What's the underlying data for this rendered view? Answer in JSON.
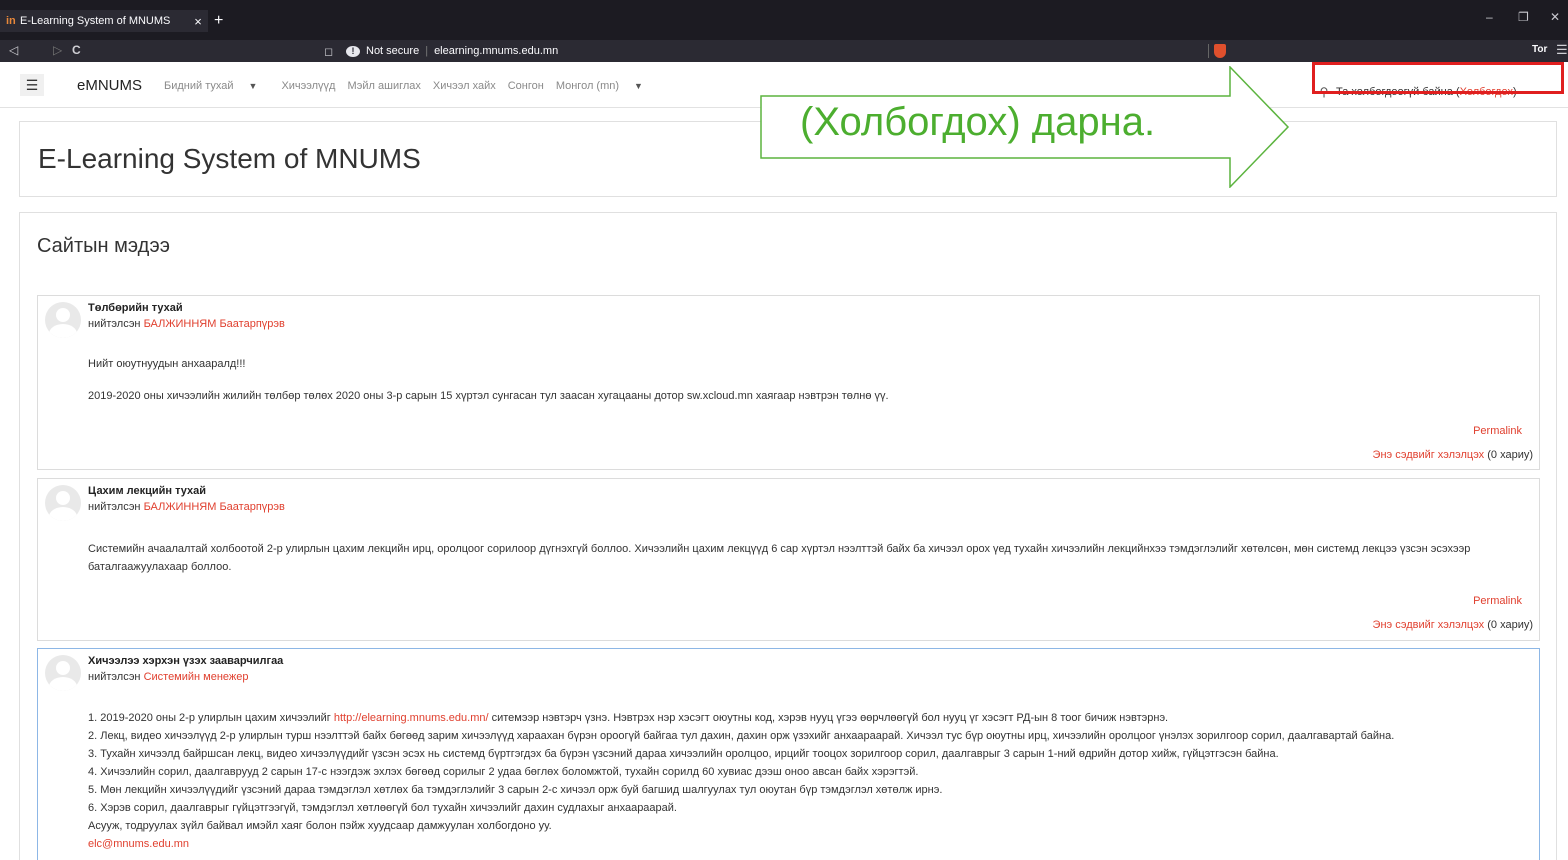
{
  "browser": {
    "tab_favicon": "in",
    "tab_title": "E-Learning System of MNUMS",
    "tab_close": "×",
    "new_tab": "+",
    "security": "Not secure",
    "url": "elearning.mnums.edu.mn",
    "tor_label": "Tor",
    "icons": [
      "back-icon",
      "forward-icon",
      "reload-icon",
      "bookmark-icon",
      "info-icon",
      "brave-shield-icon",
      "menu-icon"
    ]
  },
  "navbar": {
    "brand": "eMNUMS",
    "links": [
      {
        "label": "Бидний тухай",
        "dropdown": true
      },
      {
        "label": "Хичээлүүд",
        "dropdown": false
      },
      {
        "label": "Мэйл ашиглах",
        "dropdown": false
      },
      {
        "label": "Хичээл хайх",
        "dropdown": false
      },
      {
        "label": "Сонгон",
        "dropdown": false
      },
      {
        "label": "Монгол (mn)",
        "dropdown": true
      }
    ],
    "login_text": "Та холбогдоогүй байна (",
    "login_link": "Холбогдох",
    "login_close": ")"
  },
  "page": {
    "heading": "E-Learning System of MNUMS",
    "news_title": "Сайтын мэдээ"
  },
  "posts": [
    {
      "subject": "Төлбөрийн тухай",
      "by": "нийтэлсэн ",
      "author": "БАЛЖИННЯМ Баатарпүрэв",
      "body": [
        "Нийт оюутнуудын анхааралд!!!",
        "2019-2020 оны хичээлийн жилийн төлбөр төлөх 2020 оны 3-р сарын 15 хүртэл сунгасан тул заасан хугацааны дотор sw.xcloud.mn хаягаар нэвтрэн төлнө үү."
      ],
      "permalink": "Permalink",
      "discuss": "Энэ сэдвийг хэлэлцэх",
      "replies": " (0 хариу)"
    },
    {
      "subject": "Цахим лекцийн тухай",
      "by": "нийтэлсэн ",
      "author": "БАЛЖИННЯМ Баатарпүрэв",
      "body": [
        "Системийн ачаалалтай холбоотой 2-р улирлын цахим лекцийн ирц, оролцоог сорилоор дүгнэхгүй боллоо. Хичээлийн цахим лекцүүд 6 сар хүртэл нээлттэй байх ба хичээл орох үед тухайн хичээлийн лекцийнхээ тэмдэглэлийг хөтөлсөн, мөн системд лекцээ үзсэн эсэхээр баталгаажуулахаар боллоо."
      ],
      "permalink": "Permalink",
      "discuss": "Энэ сэдвийг хэлэлцэх",
      "replies": " (0 хариу)"
    },
    {
      "subject": "Хичээлээ хэрхэн үзэх зааварчилгаа",
      "by": "нийтэлсэн ",
      "author": "Системийн менежер",
      "line1_pre": "1. 2019-2020 оны 2-р улирлын цахим хичээлийг ",
      "line1_link": "http://elearning.mnums.edu.mn/",
      "line1_post": " ситемээр нэвтэрч үзнэ. Нэвтрэх нэр хэсэгт оюутны код, хэрэв нууц үгээ өөрчлөөгүй бол нууц үг хэсэгт РД-ын 8 тоог бичиж нэвтэрнэ.",
      "lines": [
        "2. Лекц, видео хичээлүүд 2-р улирлын турш нээлттэй байх бөгөөд зарим хичээлүүд хараахан бүрэн ороогүй байгаа тул дахин, дахин орж үзэхийг анхаараарай. Хичээл тус бүр оюутны ирц, хичээлийн оролцоог үнэлэх зорилгоор сорил, даалгавартай байна.",
        "3. Тухайн хичээлд байршсан лекц, видео хичээлүүдийг үзсэн эсэх нь системд бүртгэгдэх ба бүрэн үзсэний дараа хичээлийн оролцоо, ирцийг тооцох зорилгоор сорил, даалгаврыг 3 сарын 1-ний өдрийн дотор хийж, гүйцэтгэсэн байна.",
        "4. Хичээлийн сорил, даалгаврууд 2 сарын 17-с нээгдэж эхлэх бөгөөд сорилыг 2 удаа бөглөх боломжтой, тухайн сорилд 60 хувиас дээш оноо авсан байх хэрэгтэй.",
        "5. Мөн лекцийн хичээлүүдийг үзсэний дараа тэмдэглэл хөтлөх ба тэмдэглэлийг 3 сарын 2-с хичээл орж буй багшид шалгуулах тул оюутан бүр тэмдэглэл хөтөлж ирнэ.",
        "6. Хэрэв сорил, даалгаврыг гүйцэтгээгүй, тэмдэглэл хөтлөөгүй бол тухайн хичээлийг дахин судлахыг анхаараарай.",
        "Асууж, тодруулах зүйл байвал имэйл хаяг болон пэйж хуудсаар дамжуулан холбогдоно уу."
      ],
      "email": "elc@mnums.edu.mn"
    }
  ],
  "annotation": {
    "text": "(Холбогдох) дарна.",
    "color": "#4cae2f",
    "highlight_color": "#e01f1f"
  }
}
